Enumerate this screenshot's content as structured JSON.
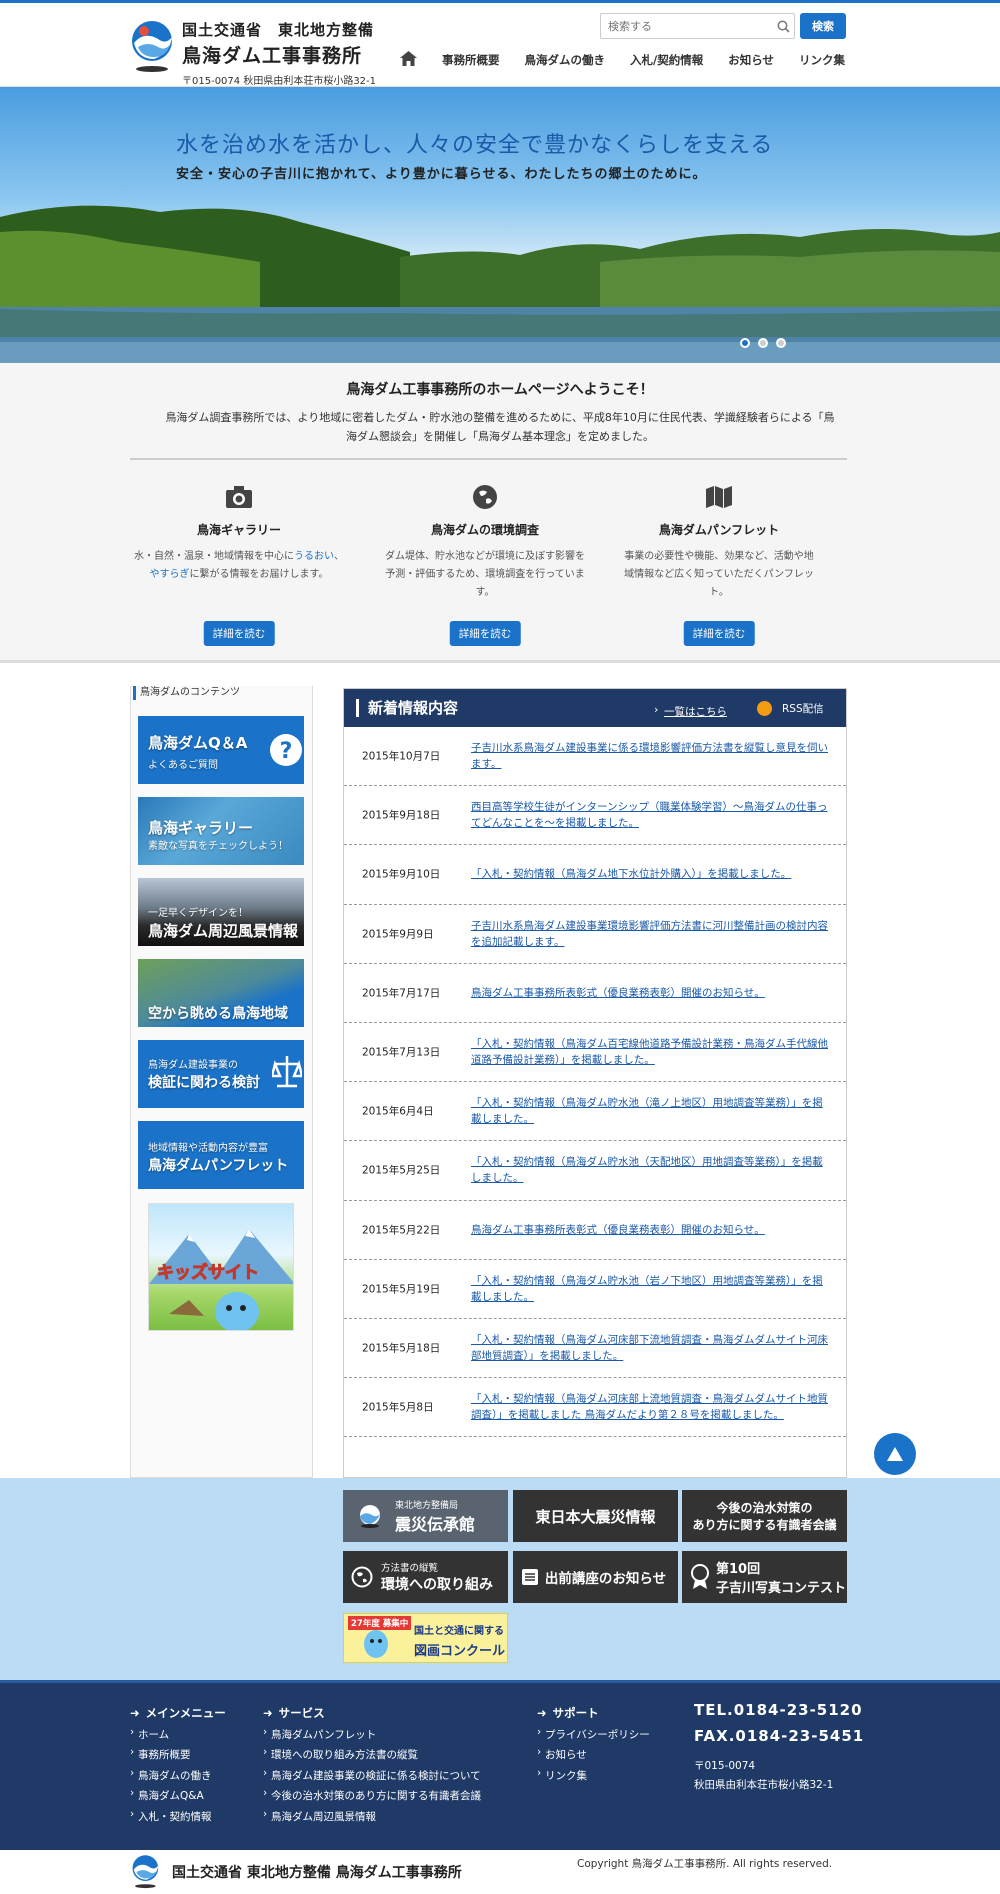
{
  "header": {
    "org_line1": "国土交通省　東北地方整備",
    "org_line2": "鳥海ダム工事事務所",
    "address": "〒015-0074 秋田県由利本荘市桜小路32-1",
    "search_placeholder": "検索する",
    "search_button": "検索",
    "nav": [
      "事務所概要",
      "鳥海ダムの働き",
      "入札/契約情報",
      "お知らせ",
      "リンク集"
    ]
  },
  "hero": {
    "title": "水を治め水を活かし、人々の安全で豊かなくらしを支える",
    "subtitle": "安全・安心の子吉川に抱かれて、より豊かに暮らせる、わたしたちの郷土のために。",
    "active_slide": 1,
    "slide_count": 3
  },
  "welcome": {
    "title": "鳥海ダム工事事務所のホームページへようこそ！",
    "desc": "鳥海ダム調査事務所では、より地域に密着したダム・貯水池の整備を進めるために、平成8年10月に住民代表、学識経験者らによる「鳥海ダム懇談会」を開催し「鳥海ダム基本理念」を定めました。",
    "features": [
      {
        "icon": "camera-icon",
        "title": "鳥海ギャラリー",
        "desc_a": "水・自然・温泉・地域情報を中心に",
        "desc_b": "うるおい",
        "desc_c": "、",
        "desc_d": "やすらぎ",
        "desc_e": "に繋がる情報をお届けします。",
        "button": "詳細を読む"
      },
      {
        "icon": "globe-icon",
        "title": "鳥海ダムの環境調査",
        "desc": "ダム堤体、貯水池などが環境に及ぼす影響を予測・評価するため、環境調査を行っています。",
        "button": "詳細を読む"
      },
      {
        "icon": "map-icon",
        "title": "鳥海ダムパンフレット",
        "desc": "事業の必要性や機能、効果など、活動や地域情報など広く知っていただくパンフレット。",
        "button": "詳細を読む"
      }
    ]
  },
  "sidebar": {
    "title": "鳥海ダムのコンテンツ",
    "banners": [
      {
        "a": "鳥海ダムQ＆A",
        "b": "よくあるご質問"
      },
      {
        "a": "鳥海ギャラリー",
        "b": "素敵な写真をチェックしよう！"
      },
      {
        "a": "一足早くデザインを！",
        "b": "鳥海ダム周辺風景情報"
      },
      {
        "a": "空から眺める鳥海地域",
        "b": ""
      },
      {
        "a": "鳥海ダム建設事業の",
        "b": "検証に関わる検討"
      },
      {
        "a": "地域情報や活動内容が豊富",
        "b": "鳥海ダムパンフレット"
      }
    ],
    "kids": "キッズサイト"
  },
  "news": {
    "title": "新着情報内容",
    "more": "一覧はこちら",
    "rss": "RSS配信",
    "items": [
      {
        "date": "2015年10月7日",
        "text": "子吉川水系鳥海ダム建設事業に係る環境影響評価方法書を縦覧し意見を伺います。"
      },
      {
        "date": "2015年9月18日",
        "text": "西目高等学校生徒がインターンシップ（職業体験学習）～鳥海ダムの仕事ってどんなことを～を掲載しました。"
      },
      {
        "date": "2015年9月10日",
        "text": "「入札・契約情報（鳥海ダム地下水位計外購入）」を掲載しました。"
      },
      {
        "date": "2015年9月9日",
        "text": "子吉川水系鳥海ダム建設事業環境影響評価方法書に河川整備計画の検討内容を追加記載します。"
      },
      {
        "date": "2015年7月17日",
        "text": "鳥海ダム工事事務所表彰式（優良業務表彰）開催のお知らせ。"
      },
      {
        "date": "2015年7月13日",
        "text": "「入札・契約情報（鳥海ダム百宅線他道路予備設計業務・鳥海ダム手代線他道路予備設計業務）」を掲載しました。"
      },
      {
        "date": "2015年6月4日",
        "text": "「入札・契約情報（鳥海ダム貯水池（滝ノ上地区）用地調査等業務）」を掲載しました。"
      },
      {
        "date": "2015年5月25日",
        "text": "「入札・契約情報（鳥海ダム貯水池（天配地区）用地調査等業務）」を掲載しました。"
      },
      {
        "date": "2015年5月22日",
        "text": "鳥海ダム工事事務所表彰式（優良業務表彰）開催のお知らせ。"
      },
      {
        "date": "2015年5月19日",
        "text": "「入札・契約情報（鳥海ダム貯水池（岩ノ下地区）用地調査等業務）」を掲載しました。"
      },
      {
        "date": "2015年5月18日",
        "text": "「入札・契約情報（鳥海ダム河床部下流地質調査・鳥海ダムダムサイト河床部地質調査）」を掲載しました。"
      },
      {
        "date": "2015年5月8日",
        "text": "「入札・契約情報（鳥海ダム河床部上流地質調査・鳥海ダムダムサイト地質調査）」を掲載しました 鳥海ダムだより第２８号を掲載しました。"
      }
    ]
  },
  "banners": {
    "b1_small": "東北地方整備局",
    "b1": "震災伝承館",
    "b2": "東日本大震災情報",
    "b3a": "今後の治水対策の",
    "b3b": "あり方に関する有識者会議",
    "b4_small": "方法書の縦覧",
    "b4": "環境への取り組み",
    "b5": "出前講座のお知らせ",
    "b6a": "第10回",
    "b6b": "子吉川写真コンテスト",
    "b7_tag": "27年度 募集中",
    "b7a": "国土と交通に関する",
    "b7b": "図画コンクール"
  },
  "footer": {
    "cols": [
      {
        "heading": "メインメニュー",
        "items": [
          "ホーム",
          "事務所概要",
          "鳥海ダムの働き",
          "鳥海ダムQ&A",
          "入札・契約情報"
        ]
      },
      {
        "heading": "サービス",
        "items": [
          "鳥海ダムパンフレット",
          "環境への取り組み方法書の縦覧",
          "鳥海ダム建設事業の検証に係る検討について",
          "今後の治水対策のあり方に関する有識者会議",
          "鳥海ダム周辺風景情報"
        ]
      },
      {
        "heading": "サポート",
        "items": [
          "プライバシーポリシー",
          "お知らせ",
          "リンク集"
        ]
      }
    ],
    "tel": "TEL.0184-23-5120",
    "fax": "FAX.0184-23-5451",
    "zip": "〒015-0074",
    "address": "秋田県由利本荘市桜小路32-1",
    "org": "国土交通省 東北地方整備 鳥海ダム工事事務所",
    "copyright": "Copyright 鳥海ダム工事事務所. All rights reserved."
  },
  "colors": {
    "accent": "#1a73c8",
    "navy": "#1f3a66",
    "banner_bg": "#bcdcf5"
  }
}
